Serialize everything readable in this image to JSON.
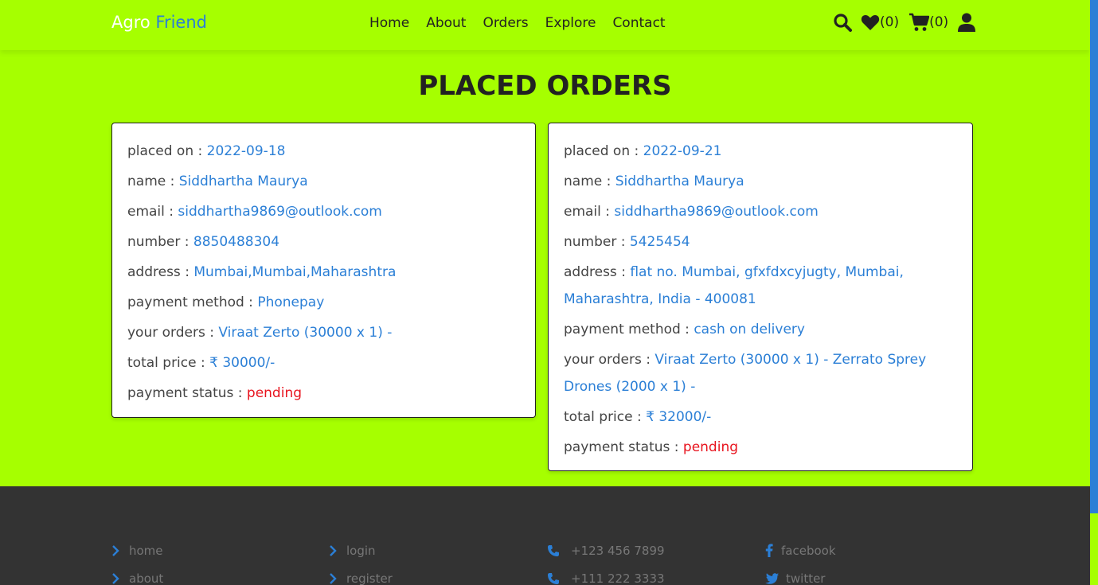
{
  "header": {
    "logo_part1": "Agro",
    "logo_part2": "Friend",
    "nav": [
      "Home",
      "About",
      "Orders",
      "Explore",
      "Contact"
    ],
    "wishlist_count": "(0)",
    "cart_count": "(0)"
  },
  "page_title": "PLACED ORDERS",
  "labels": {
    "placed_on": "placed on : ",
    "name": "name : ",
    "email": "email : ",
    "number": "number : ",
    "address": "address : ",
    "payment_method": "payment method : ",
    "your_orders": "your orders : ",
    "total_price": "total price : ",
    "payment_status": "payment status : "
  },
  "orders": [
    {
      "placed_on": "2022-09-18",
      "name": "Siddhartha Maurya",
      "email": "siddhartha9869@outlook.com",
      "number": "8850488304",
      "address": "Mumbai,Mumbai,Maharashtra",
      "payment_method": "Phonepay",
      "your_orders": "Viraat Zerto (30000 x 1) -",
      "total_price": "₹ 30000/-",
      "payment_status": "pending"
    },
    {
      "placed_on": "2022-09-21",
      "name": "Siddhartha Maurya",
      "email": "siddhartha9869@outlook.com",
      "number": "5425454",
      "address": "flat no. Mumbai, gfxfdxcyjugty, Mumbai, Maharashtra, India - 400081",
      "payment_method": "cash on delivery",
      "your_orders": "Viraat Zerto (30000 x 1) - Zerrato Sprey Drones (2000 x 1) -",
      "total_price": "₹ 32000/-",
      "payment_status": "pending"
    }
  ],
  "footer": {
    "links1": [
      "home",
      "about"
    ],
    "links2": [
      "login",
      "register"
    ],
    "phones": [
      "+123 456 7899",
      "+111 222 3333"
    ],
    "social": [
      "facebook",
      "twitter"
    ]
  },
  "colors": {
    "background": "#a6ff00",
    "accent": "#2b7fd6",
    "pending": "#e8141e",
    "footer": "#333333"
  }
}
